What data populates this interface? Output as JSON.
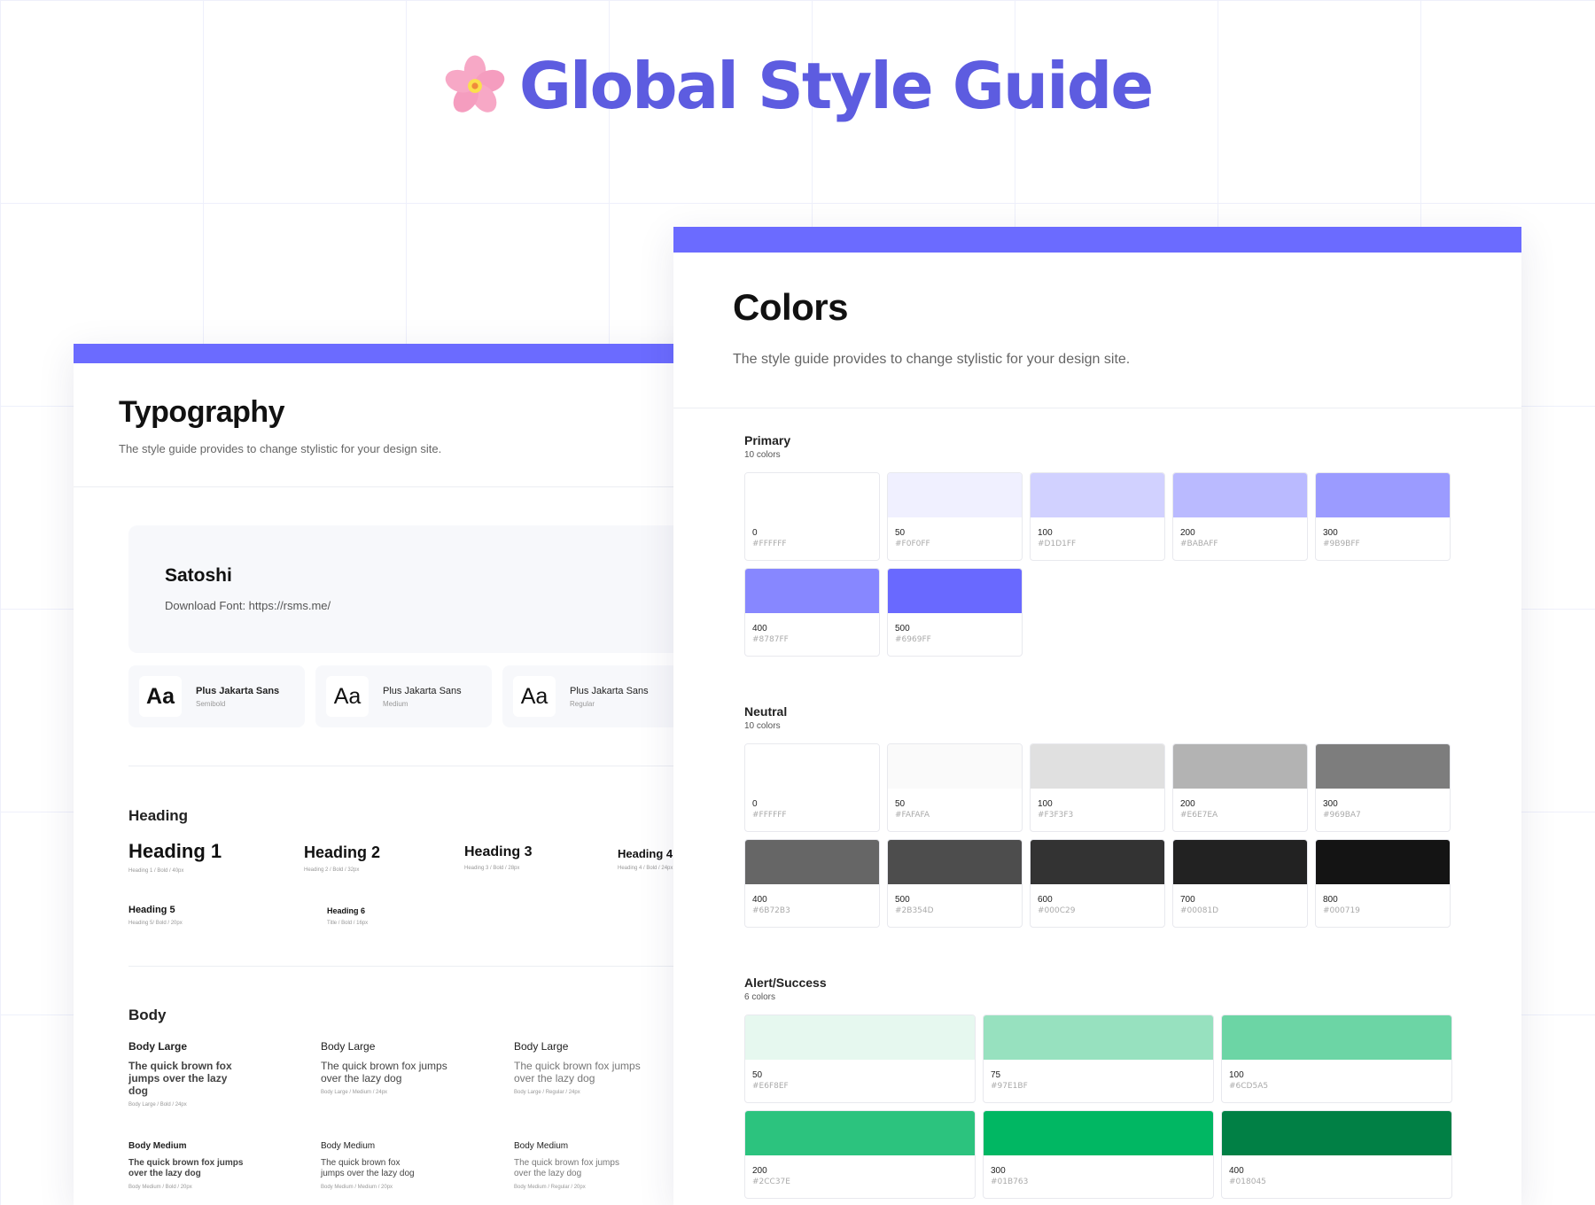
{
  "hero": {
    "title": "Global Style Guide",
    "icon": "cherry-blossom-icon"
  },
  "typography": {
    "title": "Typography",
    "subtitle": "The style guide provides to change stylistic for your design site.",
    "font": {
      "name": "Satoshi",
      "link": "Download Font: https://rsms.me/"
    },
    "weights": [
      {
        "sample": "Aa",
        "name": "Plus Jakarta Sans",
        "weight": "Semibold"
      },
      {
        "sample": "Aa",
        "name": "Plus Jakarta Sans",
        "weight": "Medium"
      },
      {
        "sample": "Aa",
        "name": "Plus Jakarta Sans",
        "weight": "Regular"
      }
    ],
    "heading_section": "Heading",
    "headings": [
      {
        "label": "Heading 1",
        "meta": "Heading 1 / Bold / 40px"
      },
      {
        "label": "Heading 2",
        "meta": "Heading 2 / Bold / 32px"
      },
      {
        "label": "Heading 3",
        "meta": "Heading 3 / Bold / 28px"
      },
      {
        "label": "Heading 4",
        "meta": "Heading 4 / Bold / 24px"
      },
      {
        "label": "Heading 5",
        "meta": "Heading 5/ Bold / 20px"
      },
      {
        "label": "Heading 6",
        "meta": "Title / Bold / 16px"
      }
    ],
    "body_section": "Body",
    "body": [
      {
        "label": "Body Large",
        "text": "The quick brown fox jumps over the lazy dog",
        "meta": "Body Large / Bold / 24px"
      },
      {
        "label": "Body Large",
        "text": "The quick brown fox jumps over the lazy dog",
        "meta": "Body Large / Medium / 24px"
      },
      {
        "label": "Body Large",
        "text": "The quick brown fox jumps over the lazy dog",
        "meta": "Body Large / Regular / 24px"
      },
      {
        "label": "Body Medium",
        "text": "The quick brown fox jumps over the lazy dog",
        "meta": "Body Medium / Bold / 20px"
      },
      {
        "label": "Body Medium",
        "text": "The quick brown fox jumps over the lazy dog",
        "meta": "Body Medium / Medium / 20px"
      },
      {
        "label": "Body Medium",
        "text": "The quick brown fox jumps over the lazy dog",
        "meta": "Body Medium / Regular / 20px"
      }
    ]
  },
  "colors": {
    "title": "Colors",
    "subtitle": "The style guide provides to change stylistic for your design site.",
    "groups": [
      {
        "title": "Primary",
        "count": "10 colors",
        "swatches": [
          {
            "name": "0",
            "hex": "#FFFFFF",
            "color": "#FFFFFF"
          },
          {
            "name": "50",
            "hex": "#F0F0FF",
            "color": "#F0F0FF"
          },
          {
            "name": "100",
            "hex": "#D1D1FF",
            "color": "#D1D1FF"
          },
          {
            "name": "200",
            "hex": "#BABAFF",
            "color": "#BABAFF"
          },
          {
            "name": "300",
            "hex": "#9B9BFF",
            "color": "#9B9BFF"
          },
          {
            "name": "400",
            "hex": "#8787FF",
            "color": "#8787FF"
          },
          {
            "name": "500",
            "hex": "#6969FF",
            "color": "#6969FF"
          }
        ]
      },
      {
        "title": "Neutral",
        "count": "10 colors",
        "swatches": [
          {
            "name": "0",
            "hex": "#FFFFFF",
            "color": "#FFFFFF"
          },
          {
            "name": "50",
            "hex": "#FAFAFA",
            "color": "#FAFAFA"
          },
          {
            "name": "100",
            "hex": "#F3F3F3",
            "color": "#E0E0E0"
          },
          {
            "name": "200",
            "hex": "#E6E7EA",
            "color": "#B3B3B3"
          },
          {
            "name": "300",
            "hex": "#969BA7",
            "color": "#7D7D7D"
          },
          {
            "name": "400",
            "hex": "#6B72B3",
            "color": "#666666"
          },
          {
            "name": "500",
            "hex": "#2B354D",
            "color": "#4D4D4D"
          },
          {
            "name": "600",
            "hex": "#000C29",
            "color": "#333333"
          },
          {
            "name": "700",
            "hex": "#00081D",
            "color": "#222222"
          },
          {
            "name": "800",
            "hex": "#000719",
            "color": "#141414"
          }
        ]
      },
      {
        "title": "Alert/Success",
        "count": "6 colors",
        "swatches": [
          {
            "name": "50",
            "hex": "#E6F8EF",
            "color": "#E6F8EF"
          },
          {
            "name": "75",
            "hex": "#97E1BF",
            "color": "#97E1BF"
          },
          {
            "name": "100",
            "hex": "#6CD5A5",
            "color": "#6CD5A5"
          },
          {
            "name": "200",
            "hex": "#2CC37E",
            "color": "#2CC37E"
          },
          {
            "name": "300",
            "hex": "#01B763",
            "color": "#01B763"
          },
          {
            "name": "400",
            "hex": "#018045",
            "color": "#018045"
          }
        ]
      }
    ]
  },
  "accent_color": "#6B6BFF",
  "title_color": "#5D5CE0"
}
